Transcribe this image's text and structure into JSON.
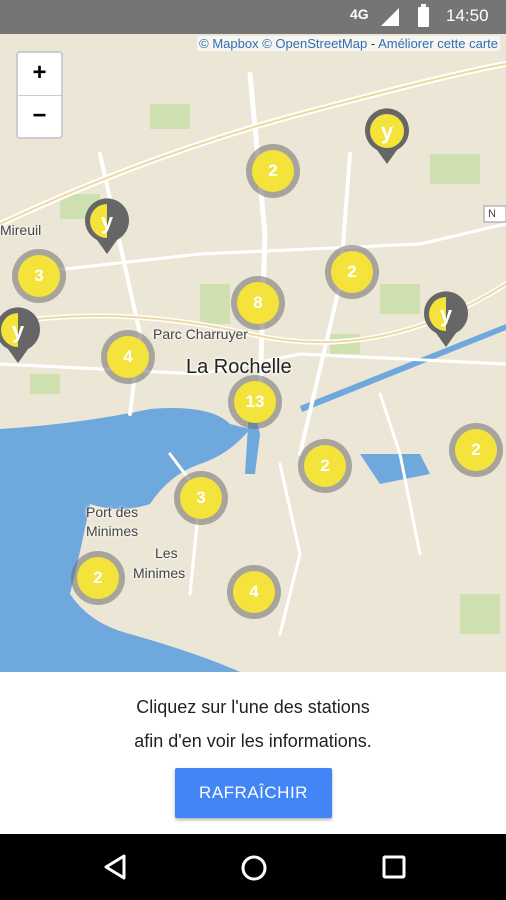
{
  "status": {
    "network": "4G",
    "time": "14:50"
  },
  "map": {
    "attribution": {
      "mapbox": "© Mapbox",
      "osm": "© OpenStreetMap",
      "improve": "Améliorer cette carte"
    },
    "zoom": {
      "in": "+",
      "out": "−"
    },
    "labels": {
      "city": "La Rochelle",
      "park": "Parc Charruyer",
      "port_l1": "Port des",
      "port_l2": "Minimes",
      "minimes_l1": "Les",
      "minimes_l2": "Minimes",
      "mireuil": "Mireuil",
      "road": "N"
    },
    "clusters": [
      "2",
      "3",
      "2",
      "8",
      "4",
      "13",
      "2",
      "2",
      "3",
      "2",
      "4"
    ],
    "pin_letter": "y"
  },
  "panel": {
    "line1": "Cliquez sur l'une des stations",
    "line2": "afin d'en voir les informations.",
    "refresh": "RAFRAÎCHIR"
  },
  "colors": {
    "accent": "#f3e33a",
    "button": "#4285f4",
    "water": "#6fa8dc"
  }
}
